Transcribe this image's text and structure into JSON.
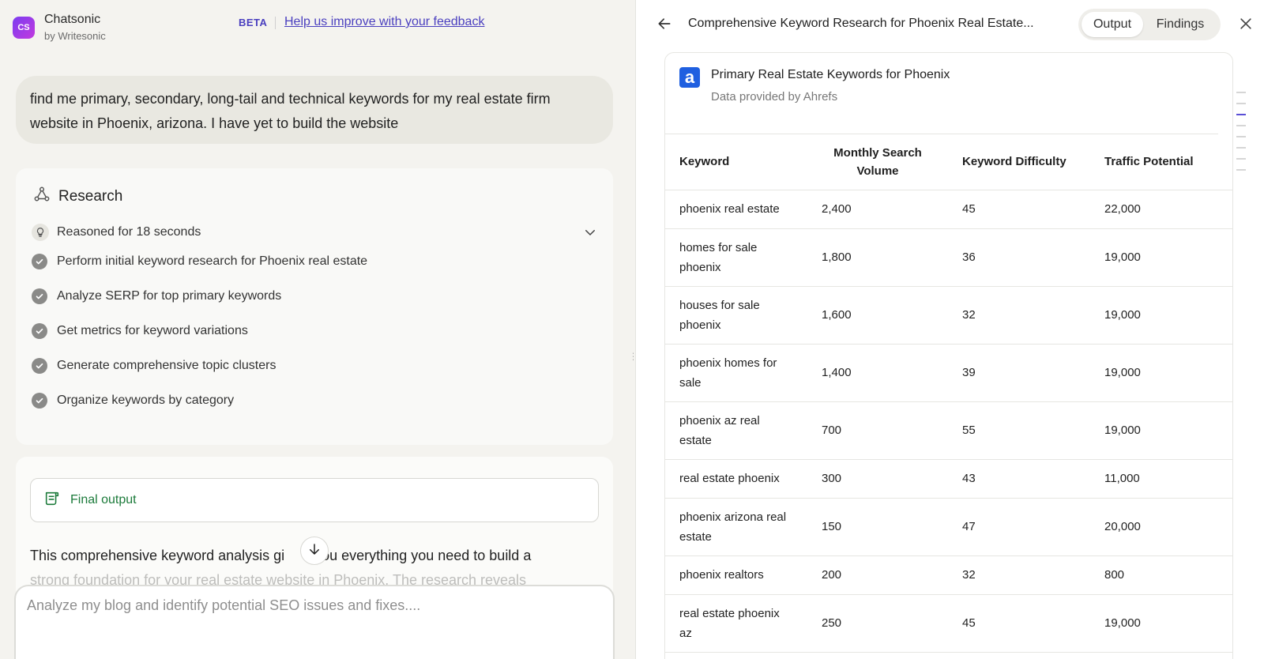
{
  "brand": {
    "logo_text": "CS",
    "name": "Chatsonic",
    "sub": "by Writesonic"
  },
  "header": {
    "beta": "BETA",
    "feedback": "Help us improve with your feedback"
  },
  "user_message": "find me primary, secondary, long-tail and technical keywords for my real estate firm website in Phoenix, arizona. I have yet to build the website",
  "research": {
    "title": "Research",
    "reasoned": "Reasoned for 18 seconds",
    "steps": [
      "Perform initial keyword research for Phoenix real estate",
      "Analyze SERP for top primary keywords",
      "Get metrics for keyword variations",
      "Generate comprehensive topic clusters",
      "Organize keywords by category"
    ]
  },
  "final_output": {
    "label": "Final output",
    "text_line1": "This comprehensive keyword analysis gi",
    "text_line1b": "you everything you need to build a",
    "text_line2": "strong foundation for your real estate website in Phoenix. The research reveals"
  },
  "composer": {
    "placeholder": "Analyze my blog and identify potential SEO issues and fixes...."
  },
  "panel": {
    "title": "Comprehensive Keyword Research for Phoenix Real Estate...",
    "tabs": [
      "Output",
      "Findings"
    ],
    "card_title": "Primary Real Estate Keywords for Phoenix",
    "card_sub": "Data provided by Ahrefs",
    "logo_letter": "a",
    "columns": [
      "Keyword",
      "Monthly Search Volume",
      "Keyword Difficulty",
      "Traffic Potential"
    ],
    "rows": [
      {
        "keyword": "phoenix real estate",
        "volume": "2,400",
        "difficulty": "45",
        "traffic": "22,000"
      },
      {
        "keyword": "homes for sale phoenix",
        "volume": "1,800",
        "difficulty": "36",
        "traffic": "19,000"
      },
      {
        "keyword": "houses for sale phoenix",
        "volume": "1,600",
        "difficulty": "32",
        "traffic": "19,000"
      },
      {
        "keyword": "phoenix homes for sale",
        "volume": "1,400",
        "difficulty": "39",
        "traffic": "19,000"
      },
      {
        "keyword": "phoenix az real estate",
        "volume": "700",
        "difficulty": "55",
        "traffic": "19,000"
      },
      {
        "keyword": "real estate phoenix",
        "volume": "300",
        "difficulty": "43",
        "traffic": "11,000"
      },
      {
        "keyword": "phoenix arizona real estate",
        "volume": "150",
        "difficulty": "47",
        "traffic": "20,000"
      },
      {
        "keyword": "phoenix realtors",
        "volume": "200",
        "difficulty": "32",
        "traffic": "800"
      },
      {
        "keyword": "real estate phoenix az",
        "volume": "250",
        "difficulty": "45",
        "traffic": "19,000"
      }
    ]
  },
  "colors": {
    "accent": "#4a3fbf",
    "success": "#1b7a3a",
    "ahrefs": "#1f5fe0"
  }
}
